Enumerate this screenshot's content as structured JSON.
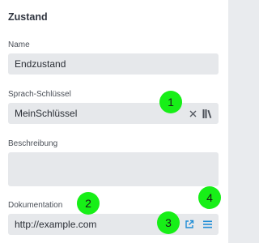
{
  "panel": {
    "title": "Zustand",
    "name": {
      "label": "Name",
      "value": "Endzustand"
    },
    "language_key": {
      "label": "Sprach-Schlüssel",
      "value": "MeinSchlüssel",
      "clear_icon": "close-icon",
      "library_icon": "library-books-icon"
    },
    "description": {
      "label": "Beschreibung",
      "value": ""
    },
    "documentation": {
      "label": "Dokumentation",
      "value": "http://example.com",
      "open_icon": "open-external-icon",
      "menu_icon": "hamburger-menu-icon"
    }
  },
  "annotations": [
    "1",
    "2",
    "3",
    "4"
  ],
  "colors": {
    "badge": "#17ef17",
    "accent_blue": "#1f8dd6",
    "field_bg": "#e6e8eb"
  }
}
